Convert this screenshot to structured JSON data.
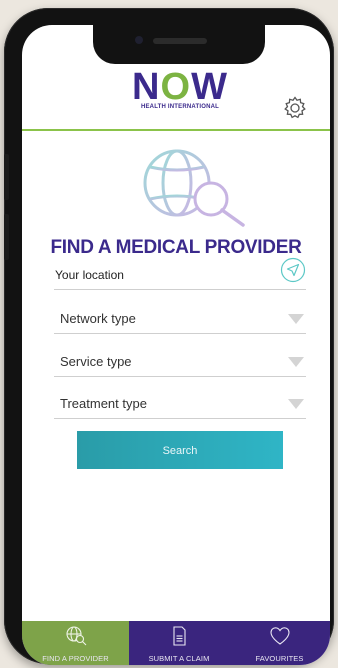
{
  "header": {
    "logo_word_n": "N",
    "logo_word_o": "O",
    "logo_word_w": "W",
    "logo_sub": "HEALTH INTERNATIONAL"
  },
  "main": {
    "title": "FIND A MEDICAL PROVIDER",
    "location_label": "Your location",
    "dropdowns": [
      {
        "label": "Network type"
      },
      {
        "label": "Service type"
      },
      {
        "label": "Treatment type"
      }
    ],
    "search_label": "Search"
  },
  "tabs": [
    {
      "label": "FIND A PROVIDER",
      "icon": "globe-search-icon"
    },
    {
      "label": "SUBMIT A CLAIM",
      "icon": "document-icon"
    },
    {
      "label": "FAVOURITES",
      "icon": "heart-icon"
    }
  ],
  "colors": {
    "brand_purple": "#3b2a8c",
    "brand_green": "#7cb342",
    "tab_active": "#7ea349",
    "tab_bar": "#3a257e",
    "search_button": "#2fb5c6",
    "accent_teal": "#3fc0c0"
  }
}
